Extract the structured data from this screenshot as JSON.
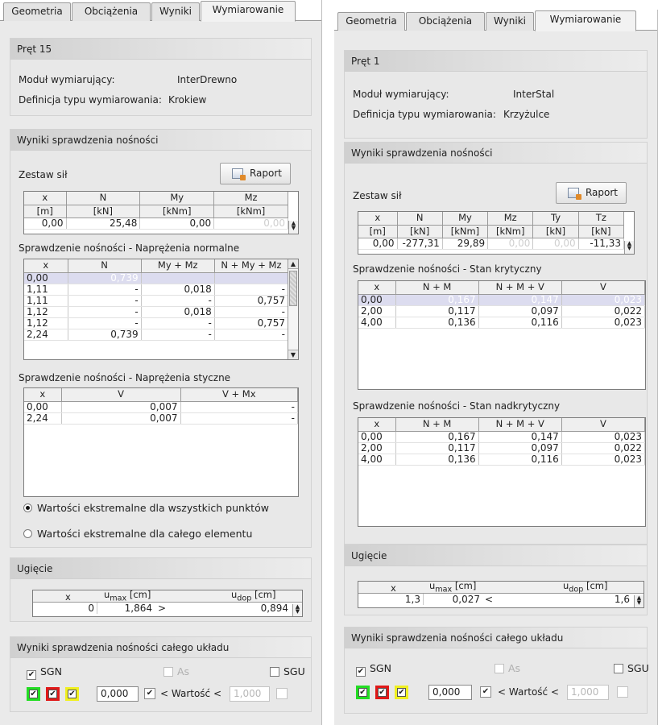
{
  "left": {
    "tabs": [
      "Geometria",
      "Obciążenia",
      "Wyniki",
      "Wymiarowanie"
    ],
    "bar": {
      "title": "Pręt 15",
      "module_label": "Moduł wymiarujący:",
      "module_value": "InterDrewno",
      "def_label": "Definicja typu wymiarowania:",
      "def_value": "Krokiew"
    },
    "results": {
      "title": "Wyniki sprawdzenia nośności",
      "forces_label": "Zestaw sił",
      "report": "Raport",
      "forces": {
        "headers": [
          "x",
          "N",
          "My",
          "Mz"
        ],
        "units": [
          "[m]",
          "[kN]",
          "[kNm]",
          "[kNm]"
        ],
        "row": [
          "0,00",
          "25,48",
          "0,00",
          "0,00"
        ]
      },
      "normal": {
        "title": "Sprawdzenie nośności - Naprężenia normalne",
        "headers": [
          "x",
          "N",
          "My + Mz",
          "N + My + Mz"
        ],
        "rows": [
          [
            "0,00",
            "0,739",
            "",
            ""
          ],
          [
            "1,11",
            "-",
            "0,018",
            "-"
          ],
          [
            "1,11",
            "-",
            "-",
            "0,757"
          ],
          [
            "1,12",
            "-",
            "0,018",
            "-"
          ],
          [
            "1,12",
            "-",
            "-",
            "0,757"
          ],
          [
            "2,24",
            "0,739",
            "-",
            "-"
          ]
        ]
      },
      "shear": {
        "title": "Sprawdzenie nośności - Naprężenia styczne",
        "headers": [
          "x",
          "V",
          "V + Mx"
        ],
        "rows": [
          [
            "0,00",
            "0,007",
            "-"
          ],
          [
            "2,24",
            "0,007",
            "-"
          ]
        ]
      },
      "radio1": "Wartości ekstremalne dla wszystkich punktów",
      "radio2": "Wartości ekstremalne dla całego elementu"
    },
    "deflection": {
      "title": "Ugięcie",
      "x_label": "x",
      "umax_label": "u",
      "umax_sub": "max",
      "umax_unit": "[cm]",
      "udop_label": "u",
      "udop_sub": "dop",
      "udop_unit": "[cm]",
      "x": "0",
      "umax": "1,864",
      "rel": ">",
      "udop": "0,894"
    },
    "system": {
      "title": "Wyniki sprawdzenia nośności całego układu",
      "sgn": "SGN",
      "as": "As",
      "sgu": "SGU",
      "min": "0,000",
      "cmp": "< Wartość <",
      "max": "1,000",
      "colors": [
        "#22dd22",
        "#e01818",
        "#f0f020"
      ]
    }
  },
  "right": {
    "tabs": [
      "Geometria",
      "Obciążenia",
      "Wyniki",
      "Wymiarowanie"
    ],
    "bar": {
      "title": "Pręt 1",
      "module_label": "Moduł wymiarujący:",
      "module_value": "InterStal",
      "def_label": "Definicja typu wymiarowania:",
      "def_value": "Krzyżulce"
    },
    "results": {
      "title": "Wyniki sprawdzenia nośności",
      "forces_label": "Zestaw sił",
      "report": "Raport",
      "forces": {
        "headers": [
          "x",
          "N",
          "My",
          "Mz",
          "Ty",
          "Tz"
        ],
        "units": [
          "[m]",
          "[kN]",
          "[kNm]",
          "[kNm]",
          "[kN]",
          "[kN]"
        ],
        "row": [
          "0,00",
          "-277,31",
          "29,89",
          "0,00",
          "0,00",
          "-11,33"
        ]
      },
      "critical": {
        "title": "Sprawdzenie nośności - Stan krytyczny",
        "headers": [
          "x",
          "N + M",
          "N + M + V",
          "V"
        ],
        "rows": [
          [
            "0,00",
            "0,167",
            "0,147",
            "0,023"
          ],
          [
            "2,00",
            "0,117",
            "0,097",
            "0,022"
          ],
          [
            "4,00",
            "0,136",
            "0,116",
            "0,023"
          ]
        ]
      },
      "supercritical": {
        "title": "Sprawdzenie nośności - Stan nadkrytyczny",
        "headers": [
          "x",
          "N + M",
          "N + M + V",
          "V"
        ],
        "rows": [
          [
            "0,00",
            "0,167",
            "0,147",
            "0,023"
          ],
          [
            "2,00",
            "0,117",
            "0,097",
            "0,022"
          ],
          [
            "4,00",
            "0,136",
            "0,116",
            "0,023"
          ]
        ]
      }
    },
    "deflection": {
      "title": "Ugięcie",
      "x_label": "x",
      "umax_label": "u",
      "umax_sub": "max",
      "umax_unit": "[cm]",
      "udop_label": "u",
      "udop_sub": "dop",
      "udop_unit": "[cm]",
      "x": "1,3",
      "umax": "0,027",
      "rel": "<",
      "udop": "1,6"
    },
    "system": {
      "title": "Wyniki sprawdzenia nośności całego układu",
      "sgn": "SGN",
      "as": "As",
      "sgu": "SGU",
      "min": "0,000",
      "cmp": "< Wartość <",
      "max": "1,000"
    }
  }
}
